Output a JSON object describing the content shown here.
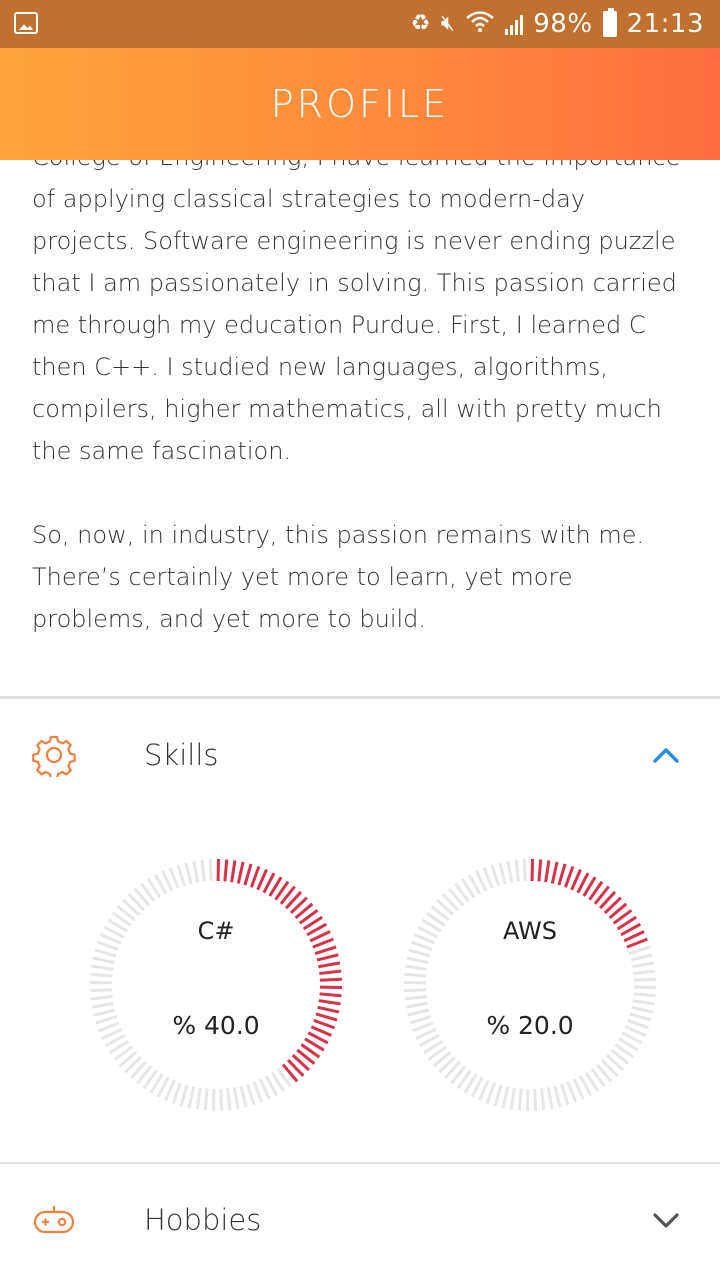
{
  "status_bar": {
    "battery": "98%",
    "time": "21:13",
    "icons": [
      "gallery-icon",
      "battery-saver-icon",
      "mute-icon",
      "wifi-icon",
      "signal-icon",
      "battery-icon"
    ]
  },
  "header": {
    "title": "PROFILE"
  },
  "bio": {
    "paragraph_1": "College of Engineering, I have learned the importance of applying classical strategies to modern-day projects. Software engineering is never ending puzzle that I am passionately in solving. This passion carried me through my education Purdue. First, I learned C then C++. I studied new languages, algorithms, compilers, higher mathematics, all with pretty much the same fascination.",
    "paragraph_2": "So, now, in industry, this passion remains with me. There’s certainly yet more to learn, yet more problems, and yet more to build."
  },
  "sections": {
    "skills": {
      "label": "Skills",
      "icon": "gear-icon",
      "expanded": true
    },
    "hobbies": {
      "label": "Hobbies",
      "icon": "gamepad-icon",
      "expanded": false
    }
  },
  "skills": [
    {
      "name": "C#",
      "percent": 40.0,
      "value_label": "% 40.0"
    },
    {
      "name": "AWS",
      "percent": 20.0,
      "value_label": "% 20.0"
    }
  ],
  "colors": {
    "header_gradient_start": "#ffa33a",
    "header_gradient_end": "#ff6e3f",
    "status_bar": "#c0712f",
    "accent_orange": "#f08040",
    "gauge_fill": "#d6334a",
    "gauge_track": "#e6e6e6",
    "chevron_blue": "#2a8ee0"
  }
}
